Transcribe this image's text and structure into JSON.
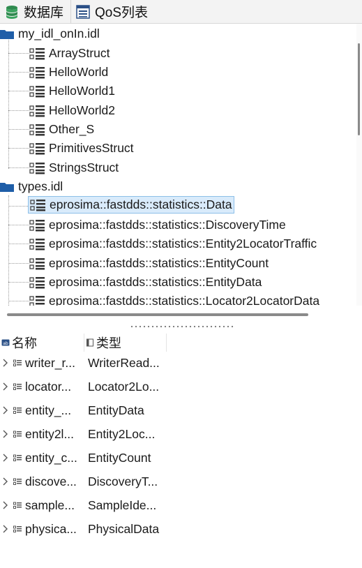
{
  "tabs": [
    {
      "label": "数据库",
      "icon": "database-icon",
      "active": true
    },
    {
      "label": "QoS列表",
      "icon": "qos-list-icon",
      "active": false
    }
  ],
  "tree": {
    "files": [
      {
        "name": "my_idl_onIn.idl",
        "icon": "folder-icon",
        "items": [
          "ArrayStruct",
          "HelloWorld",
          "HelloWorld1",
          "HelloWorld2",
          "Other_S",
          "PrimitivesStruct",
          "StringsStruct"
        ]
      },
      {
        "name": "types.idl",
        "icon": "folder-icon",
        "items": [
          "eprosima::fastdds::statistics::Data",
          "eprosima::fastdds::statistics::DiscoveryTime",
          "eprosima::fastdds::statistics::Entity2LocatorTraffic",
          "eprosima::fastdds::statistics::EntityCount",
          "eprosima::fastdds::statistics::EntityData",
          "eprosima::fastdds::statistics::Locator2LocatorData"
        ],
        "selected_index": 0
      }
    ]
  },
  "table": {
    "headers": {
      "name": "名称",
      "type": "类型"
    },
    "rows": [
      {
        "name": "writer_r...",
        "type": "WriterRead..."
      },
      {
        "name": "locator...",
        "type": "Locator2Lo..."
      },
      {
        "name": "entity_...",
        "type": "EntityData"
      },
      {
        "name": "entity2l...",
        "type": "Entity2Loc..."
      },
      {
        "name": "entity_c...",
        "type": "EntityCount"
      },
      {
        "name": "discove...",
        "type": "DiscoveryT..."
      },
      {
        "name": "sample...",
        "type": "SampleIde..."
      },
      {
        "name": "physica...",
        "type": "PhysicalData"
      }
    ]
  },
  "colors": {
    "folder": "#1f5ea8",
    "selection_bg": "#d9ebfb",
    "selection_border": "#8cbfe8",
    "database_icon": "#2f8a4f"
  }
}
